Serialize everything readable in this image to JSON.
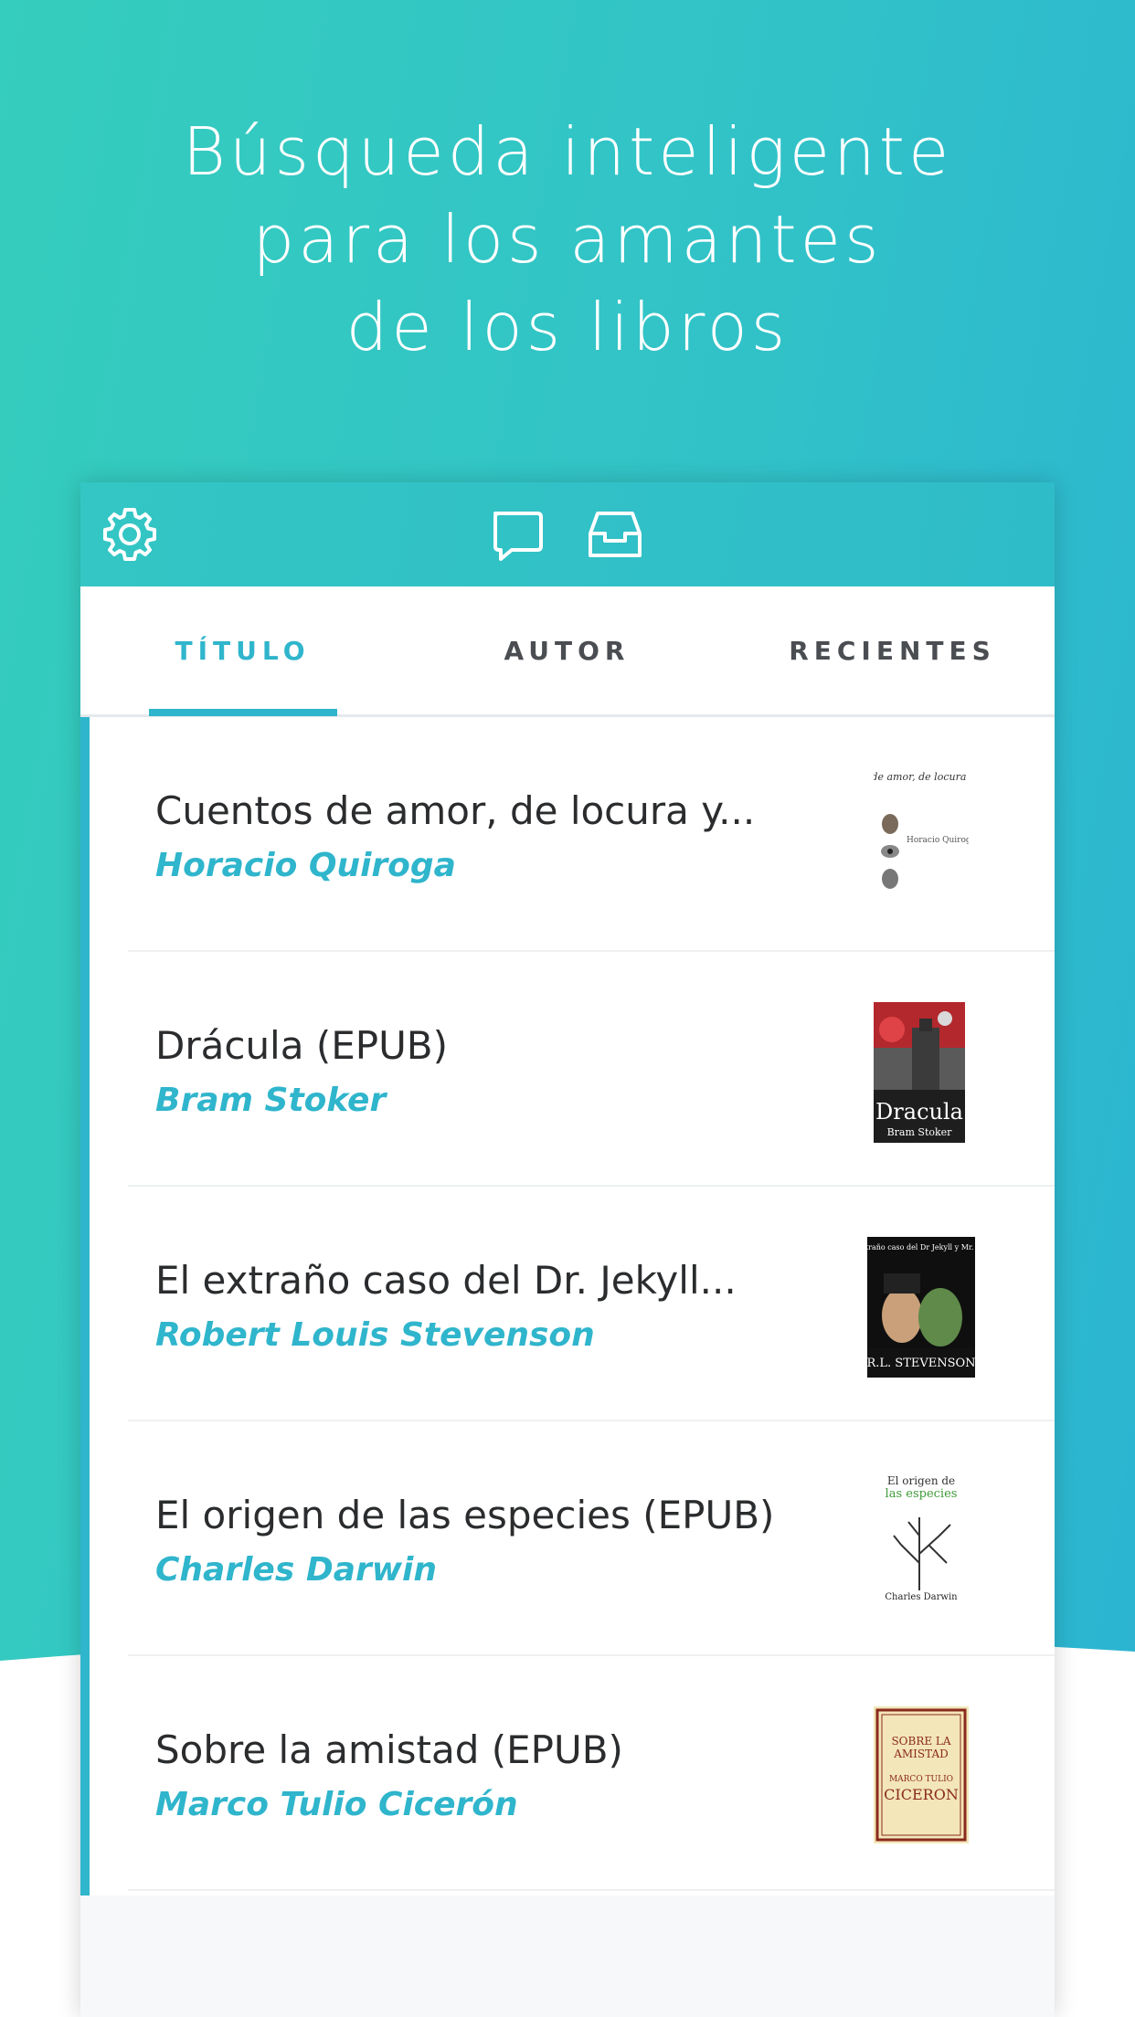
{
  "headline": {
    "line1": "Búsqueda inteligente",
    "line2": "para los amantes",
    "line3": "de los libros"
  },
  "toolbar": {
    "icons": [
      "gear-icon",
      "chat-bubble-icon",
      "inbox-tray-icon"
    ]
  },
  "tabs": [
    {
      "label": "TÍTULO",
      "active": true
    },
    {
      "label": "AUTOR",
      "active": false
    },
    {
      "label": "RECIENTES",
      "active": false
    }
  ],
  "books": [
    {
      "title": "Cuentos de amor, de locura y...",
      "author": "Horacio Quiroga",
      "cover": {
        "title": "Cuentos de amor, de locura y de muerte",
        "author": "Horacio Quiroga"
      }
    },
    {
      "title": "Drácula (EPUB)",
      "author": "Bram Stoker",
      "cover": {
        "title": "Dracula",
        "author": "Bram Stoker"
      }
    },
    {
      "title": "El extraño caso del Dr. Jekyll...",
      "author": "Robert Louis Stevenson",
      "cover": {
        "title": "El extraño caso del Dr Jekyll y Mr. Hyde",
        "author": "R.L. STEVENSON"
      }
    },
    {
      "title": "El origen de las especies (EPUB)",
      "author": "Charles Darwin",
      "cover": {
        "title_line1": "El origen de",
        "title_line2": "las especies",
        "author": "Charles Darwin"
      }
    },
    {
      "title": "Sobre la amistad (EPUB)",
      "author": "Marco Tulio Cicerón",
      "cover": {
        "title_line1": "SOBRE LA",
        "title_line2": "AMISTAD",
        "author_line1": "MARCO TULIO",
        "author_line2": "CICERON"
      }
    }
  ],
  "colors": {
    "accent": "#2fb5cc",
    "background_start": "#35cdbd",
    "background_end": "#2bb3d2",
    "text_dark": "#2a2c2e"
  }
}
